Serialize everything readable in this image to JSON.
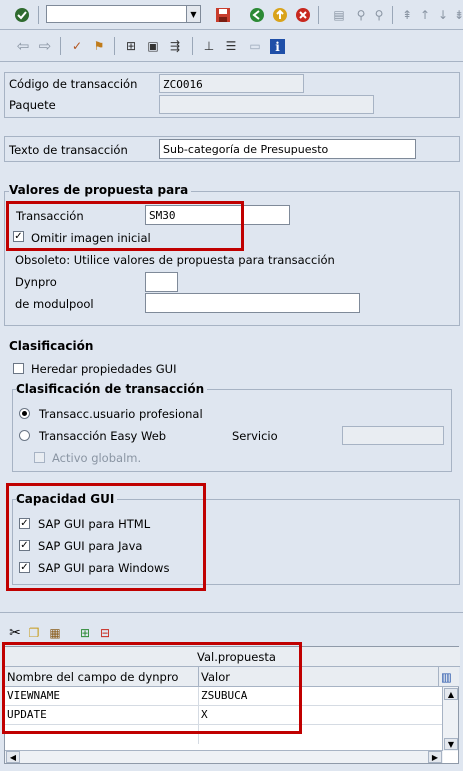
{
  "toolbar1": {
    "command_field": "",
    "icons": [
      "ok-icon",
      "save-icon",
      "back-icon",
      "exit-icon",
      "cancel-icon",
      "print-icon",
      "find-icon",
      "find-next-icon",
      "first-page-icon",
      "prev-page-icon",
      "next-page-icon",
      "last-page-icon"
    ]
  },
  "toolbar2": {
    "icons": [
      "prev-arrow-icon",
      "next-arrow-icon",
      "check-icon",
      "activate-icon",
      "where-used-icon",
      "display-object-icon",
      "navigate-icon",
      "hierarchy-icon",
      "display-list-icon",
      "window-icon",
      "info-icon"
    ]
  },
  "header": {
    "tcode_label": "Código de transacción",
    "tcode_value": "ZCO016",
    "package_label": "Paquete",
    "package_value": "",
    "text_label": "Texto de transacción",
    "text_value": "Sub-categoría de Presupuesto"
  },
  "defaults": {
    "title": "Valores de propuesta para",
    "transaction_label": "Transacción",
    "transaction_value": "SM30",
    "skip_label": "Omitir imagen inicial",
    "obsolete_text": "Obsoleto: Utilice valores de propuesta para transacción",
    "dynpro_label": "Dynpro",
    "dynpro_value": "",
    "modulpool_label": "de modulpool",
    "modulpool_value": ""
  },
  "classification": {
    "title": "Clasificación",
    "inherit_label": "Heredar propiedades GUI",
    "subtitle": "Clasificación de transacción",
    "option_pro": "Transacc.usuario profesional",
    "option_web": "Transacción Easy Web",
    "service_label": "Servicio",
    "service_value": "",
    "global_label": "Activo globalm."
  },
  "gui": {
    "title": "Capacidad GUI",
    "html_label": "SAP GUI para HTML",
    "java_label": "SAP GUI para Java",
    "windows_label": "SAP GUI para Windows"
  },
  "table_toolbar": {
    "icons": [
      "cut-icon",
      "copy-icon",
      "paste-icon",
      "insert-row-icon",
      "delete-row-icon"
    ]
  },
  "table": {
    "group_header": "Val.propuesta",
    "col1": "Nombre del campo de dynpro",
    "col2": "Valor",
    "rows": [
      {
        "name": "VIEWNAME",
        "value": "ZSUBUCA"
      },
      {
        "name": "UPDATE",
        "value": "X"
      }
    ]
  }
}
